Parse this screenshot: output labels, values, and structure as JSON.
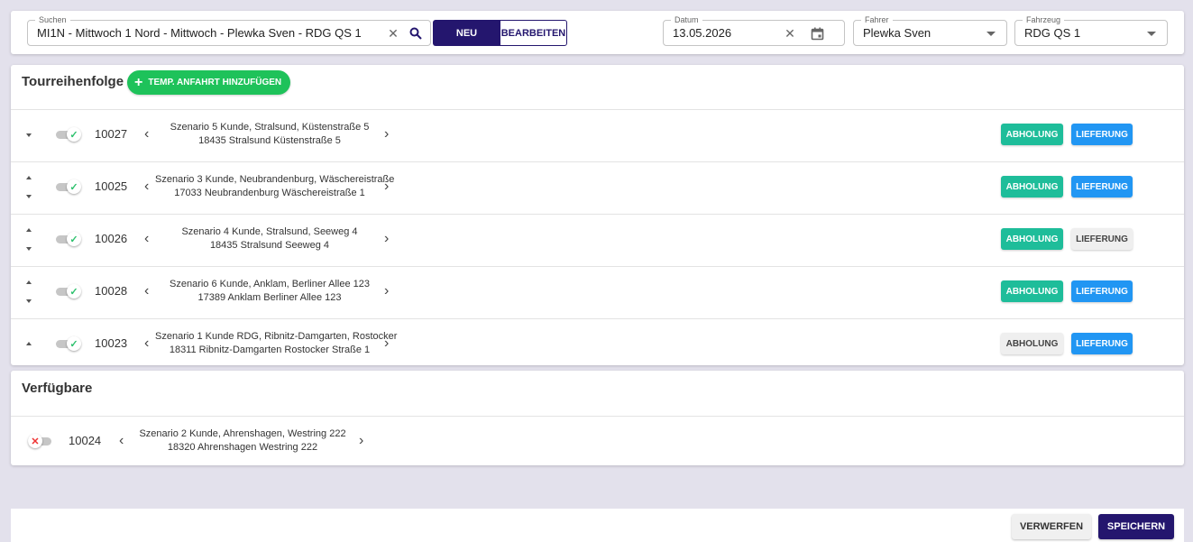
{
  "header": {
    "search": {
      "label": "Suchen",
      "value": "MI1N - Mittwoch 1 Nord - Mittwoch - Plewka Sven - RDG QS 1"
    },
    "neu_label": "NEU",
    "bearbeiten_label": "BEARBEITEN",
    "datum": {
      "label": "Datum",
      "value": "13.05.2026"
    },
    "fahrer": {
      "label": "Fahrer",
      "value": "Plewka Sven"
    },
    "fahrzeug": {
      "label": "Fahrzeug",
      "value": "RDG QS 1"
    }
  },
  "tour": {
    "title": "Tourreihenfolge",
    "add_button_label": "TEMP. ANFAHRT HINZUFÜGEN",
    "rows": [
      {
        "id": "10027",
        "line1": "Szenario 5 Kunde, Stralsund, Küstenstraße 5",
        "line2": "18435 Stralsund Küstenstraße 5",
        "active": true,
        "abholung": true,
        "lieferung": true,
        "can_up": false,
        "can_down": true
      },
      {
        "id": "10025",
        "line1": "Szenario 3 Kunde, Neubrandenburg, Wäschereistraße",
        "line2": "17033 Neubrandenburg Wäschereistraße 1",
        "active": true,
        "abholung": true,
        "lieferung": true,
        "can_up": true,
        "can_down": true
      },
      {
        "id": "10026",
        "line1": "Szenario 4 Kunde, Stralsund, Seeweg 4",
        "line2": "18435 Stralsund Seeweg 4",
        "active": true,
        "abholung": true,
        "lieferung": false,
        "can_up": true,
        "can_down": true
      },
      {
        "id": "10028",
        "line1": "Szenario 6 Kunde, Anklam, Berliner Allee 123",
        "line2": "17389 Anklam Berliner Allee 123",
        "active": true,
        "abholung": true,
        "lieferung": true,
        "can_up": true,
        "can_down": true
      },
      {
        "id": "10023",
        "line1": "Szenario 1 Kunde RDG, Ribnitz-Damgarten, Rostocker",
        "line2": "18311 Ribnitz-Damgarten Rostocker Straße 1",
        "active": true,
        "abholung": false,
        "lieferung": true,
        "can_up": true,
        "can_down": false
      }
    ],
    "abholung_label": "ABHOLUNG",
    "lieferung_label": "LIEFERUNG"
  },
  "available": {
    "title": "Verfügbare",
    "rows": [
      {
        "id": "10024",
        "line1": "Szenario 2 Kunde, Ahrenshagen, Westring 222",
        "line2": "18320 Ahrenshagen Westring 222",
        "active": false
      }
    ]
  },
  "footer": {
    "verwerfen_label": "VERWERFEN",
    "speichern_label": "SPEICHERN"
  },
  "colors": {
    "primary": "#24166e",
    "add_green": "#1ec25a",
    "abholung_teal": "#1ebd9a",
    "lieferung_blue": "#2196f3",
    "background": "#e3e1ec"
  },
  "icons": {
    "clear": "close-icon",
    "search": "search-icon",
    "calendar": "calendar-icon",
    "dropdown": "chevron-down-icon",
    "add": "plus-icon",
    "prev": "chevron-left-icon",
    "next": "chevron-right-icon"
  }
}
